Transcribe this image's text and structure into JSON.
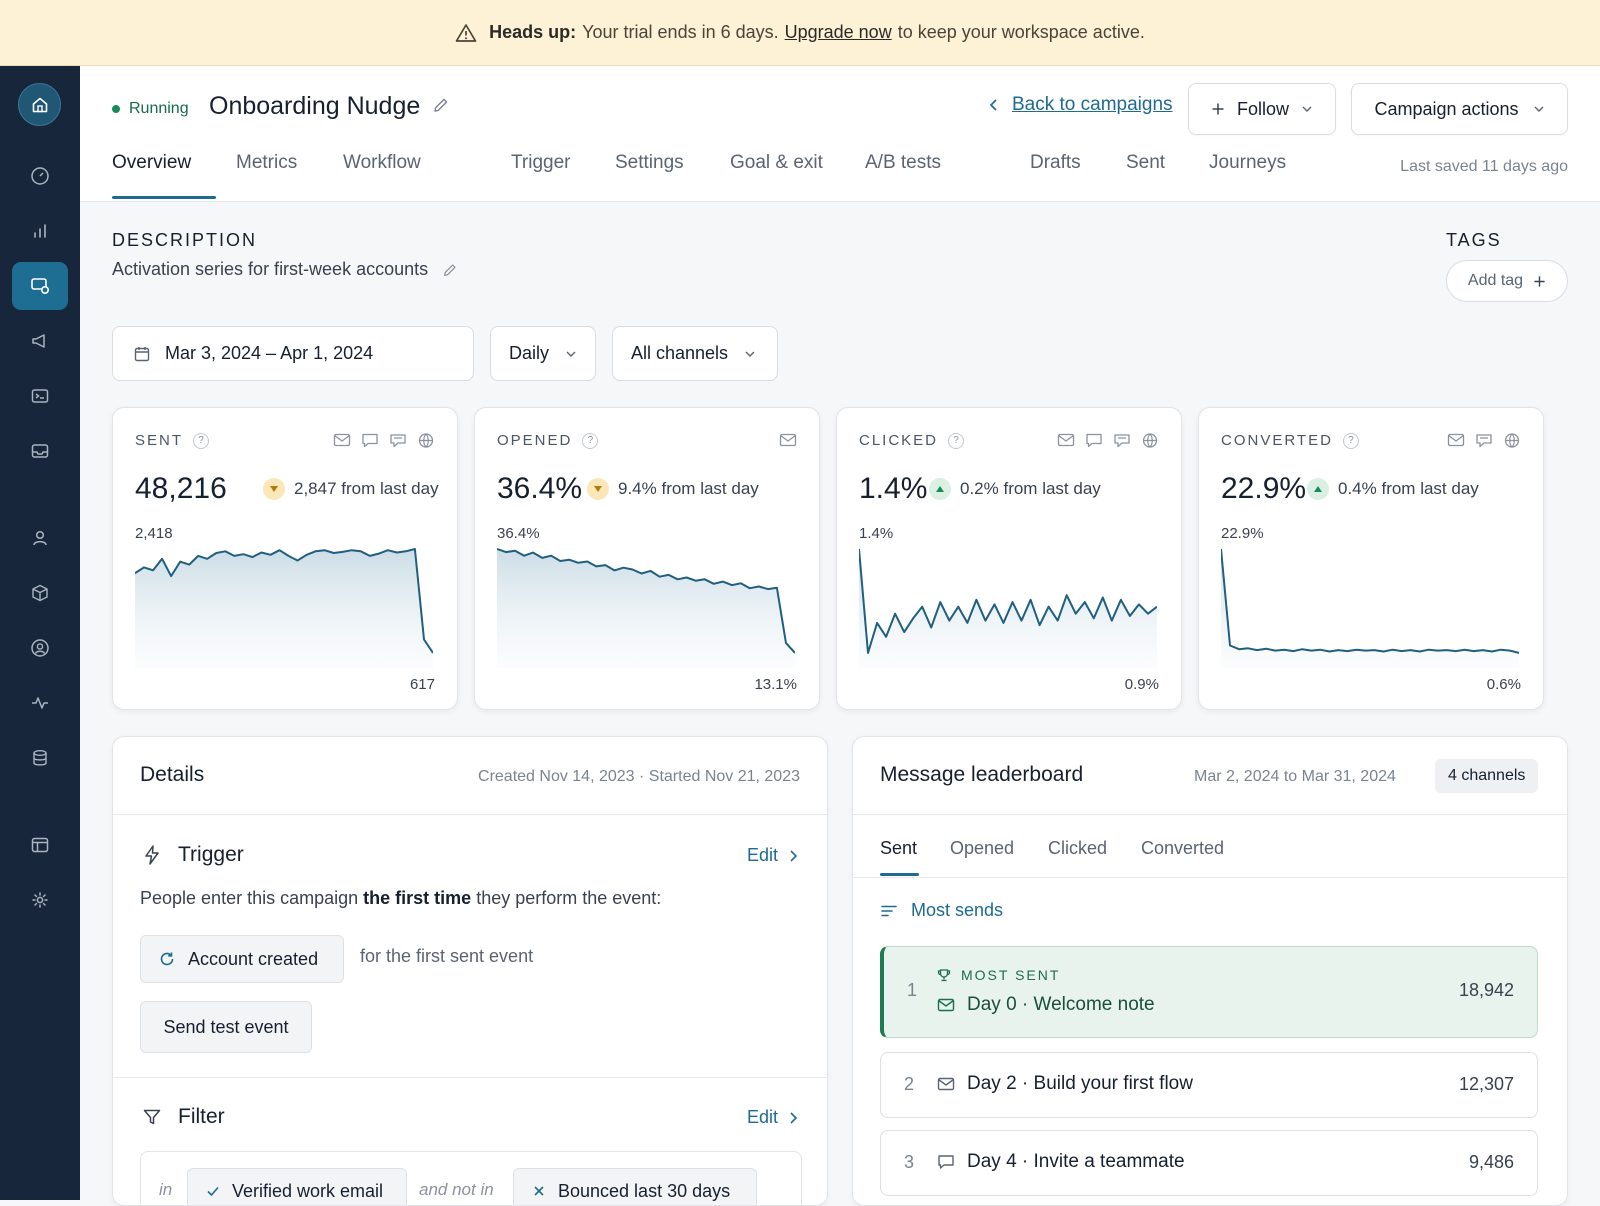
{
  "banner": {
    "heads_up": "Heads up:",
    "text_before": "Your trial ends in 6 days.",
    "link": "Upgrade now",
    "text_after": "to keep your workspace active."
  },
  "campaign": {
    "status": "Running",
    "title": "Onboarding Nudge"
  },
  "header": {
    "back_label": "Back to campaigns",
    "follow_label": "Follow",
    "actions_label": "Campaign actions",
    "last_saved": "Last saved 11 days ago"
  },
  "tabs": [
    "Overview",
    "Metrics",
    "Workflow",
    "Trigger",
    "Settings",
    "Goal & exit",
    "A/B tests",
    "Drafts",
    "Sent",
    "Journeys"
  ],
  "description": {
    "label": "DESCRIPTION",
    "text": "Activation series for first-week accounts"
  },
  "tags": {
    "label": "TAGS",
    "add_label": "Add tag"
  },
  "filters": {
    "date_range": "Mar 3, 2024 – Apr 1, 2024",
    "interval": "Daily",
    "channels": "All channels"
  },
  "metrics": [
    {
      "label": "SENT",
      "value": "48,216",
      "delta": "2,847 from last day",
      "trend": "down",
      "max": "2,418",
      "min": "617",
      "channels": [
        "email-icon",
        "chat-icon",
        "inapp-icon",
        "web-icon"
      ],
      "series": [
        2000,
        2100,
        2050,
        2250,
        1950,
        2200,
        2150,
        2300,
        2250,
        2350,
        2380,
        2300,
        2330,
        2280,
        2360,
        2320,
        2400,
        2300,
        2220,
        2320,
        2380,
        2400,
        2350,
        2370,
        2400,
        2380,
        2300,
        2340,
        2400,
        2360,
        2380,
        2420,
        850,
        617
      ]
    },
    {
      "label": "OPENED",
      "value": "36.4%",
      "delta": "9.4% from last day",
      "trend": "down",
      "max": "36.4%",
      "min": "13.1%",
      "channels": [
        "email-icon"
      ],
      "series": [
        36.4,
        35.7,
        36.0,
        34.9,
        35.6,
        34.4,
        34.9,
        33.7,
        34.0,
        33.3,
        33.6,
        32.5,
        32.8,
        31.6,
        32.2,
        31.8,
        30.9,
        31.5,
        30.2,
        30.6,
        29.6,
        30.0,
        29.3,
        29.6,
        28.6,
        29.1,
        28.3,
        28.7,
        27.6,
        28.0,
        27.4,
        27.7,
        15.3,
        13.1
      ]
    },
    {
      "label": "CLICKED",
      "value": "1.4%",
      "delta": "0.2% from last day",
      "trend": "up",
      "max": "1.4%",
      "min": "0.9%",
      "channels": [
        "email-icon",
        "chat-icon",
        "inapp-icon",
        "web-icon"
      ],
      "series": [
        1.4,
        0.95,
        1.08,
        1.02,
        1.12,
        1.04,
        1.1,
        1.15,
        1.06,
        1.17,
        1.09,
        1.15,
        1.08,
        1.18,
        1.09,
        1.16,
        1.08,
        1.17,
        1.09,
        1.18,
        1.07,
        1.15,
        1.09,
        1.2,
        1.12,
        1.17,
        1.1,
        1.19,
        1.09,
        1.18,
        1.11,
        1.16,
        1.12,
        1.15
      ]
    },
    {
      "label": "CONVERTED",
      "value": "22.9%",
      "delta": "0.4% from last day",
      "trend": "up",
      "max": "22.9%",
      "min": "0.6%",
      "channels": [
        "email-icon",
        "inapp-icon",
        "web-icon"
      ],
      "series": [
        22.9,
        2.2,
        1.4,
        1.6,
        1.2,
        1.5,
        1.1,
        1.3,
        1.0,
        1.4,
        1.1,
        1.3,
        0.9,
        1.2,
        1.0,
        1.3,
        1.1,
        1.2,
        0.9,
        1.3,
        1.0,
        1.2,
        0.9,
        1.3,
        1.1,
        1.2,
        1.0,
        1.3,
        1.0,
        1.2,
        0.9,
        1.3,
        1.1,
        0.6
      ]
    }
  ],
  "details": {
    "title": "Details",
    "meta": "Created Nov 14, 2023 · Started Nov 21, 2023",
    "trigger_title": "Trigger",
    "edit_label": "Edit",
    "trigger_text_before": "People enter this campaign",
    "trigger_text_bold": "the first time",
    "trigger_text_after": "they perform the event:",
    "event_name": "Account created",
    "event_qualifier": "for the first sent event",
    "send_test_label": "Send test event",
    "filter_title": "Filter",
    "filter_in": "in",
    "filter_in_value": "Verified work email",
    "filter_not_in": "and not in",
    "filter_not_in_value": "Bounced last 30 days"
  },
  "leaderboard": {
    "title": "Message leaderboard",
    "range": "Mar 2, 2024 to Mar 31, 2024",
    "channels_badge": "4 channels",
    "tabs": [
      "Sent",
      "Opened",
      "Clicked",
      "Converted"
    ],
    "sort_label": "Most sends",
    "top_badge": "MOST SENT",
    "rows": [
      {
        "rank": "1",
        "name": "Day 0 · Welcome note",
        "value": "18,942",
        "icon": "email-icon"
      },
      {
        "rank": "2",
        "name": "Day 2 · Build your first flow",
        "value": "12,307",
        "icon": "email-icon"
      },
      {
        "rank": "3",
        "name": "Day 4 · Invite a teammate",
        "value": "9,486",
        "icon": "chat-icon"
      }
    ]
  },
  "colors": {
    "accent": "#1d6b91",
    "sidebar": "#17263a",
    "running": "#1b8a5a",
    "banner": "#fdf1d6",
    "spark_line": "#1f5f80"
  }
}
